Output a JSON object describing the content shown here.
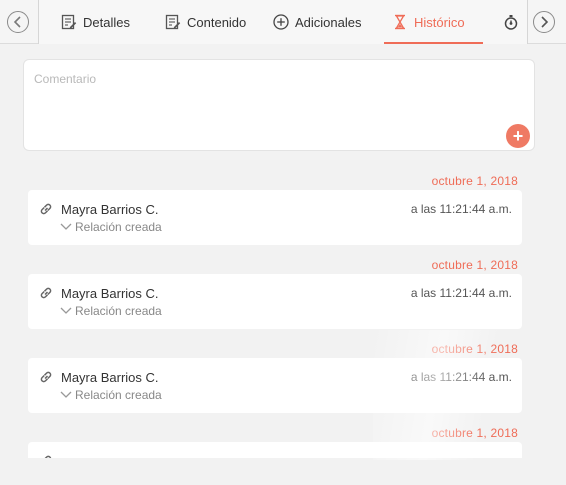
{
  "tabs": [
    {
      "label": "Detalles",
      "icon": "document-edit-icon"
    },
    {
      "label": "Contenido",
      "icon": "document-edit-icon"
    },
    {
      "label": "Adicionales",
      "icon": "plus-circle-icon"
    },
    {
      "label": "Histórico",
      "icon": "hourglass-icon",
      "active": true
    },
    {
      "label": "",
      "icon": "stopwatch-icon"
    }
  ],
  "comment": {
    "placeholder": "Comentario",
    "add_button": "+"
  },
  "history": [
    {
      "date": "octubre 1, 2018",
      "user": "Mayra Barrios C.",
      "time": "a las 11:21:44 a.m.",
      "action": "Relación creada"
    },
    {
      "date": "octubre 1, 2018",
      "user": "Mayra Barrios C.",
      "time": "a las 11:21:44 a.m.",
      "action": "Relación creada"
    },
    {
      "date": "octubre 1, 2018",
      "user": "Mayra Barrios C.",
      "time": "a las 11:21:44 a.m.",
      "action": "Relación creada"
    },
    {
      "date": "octubre 1, 2018",
      "user": "",
      "time": "",
      "action": ""
    }
  ],
  "colors": {
    "accent": "#ef6c57",
    "background": "#f2f2f2",
    "card": "#ffffff"
  }
}
